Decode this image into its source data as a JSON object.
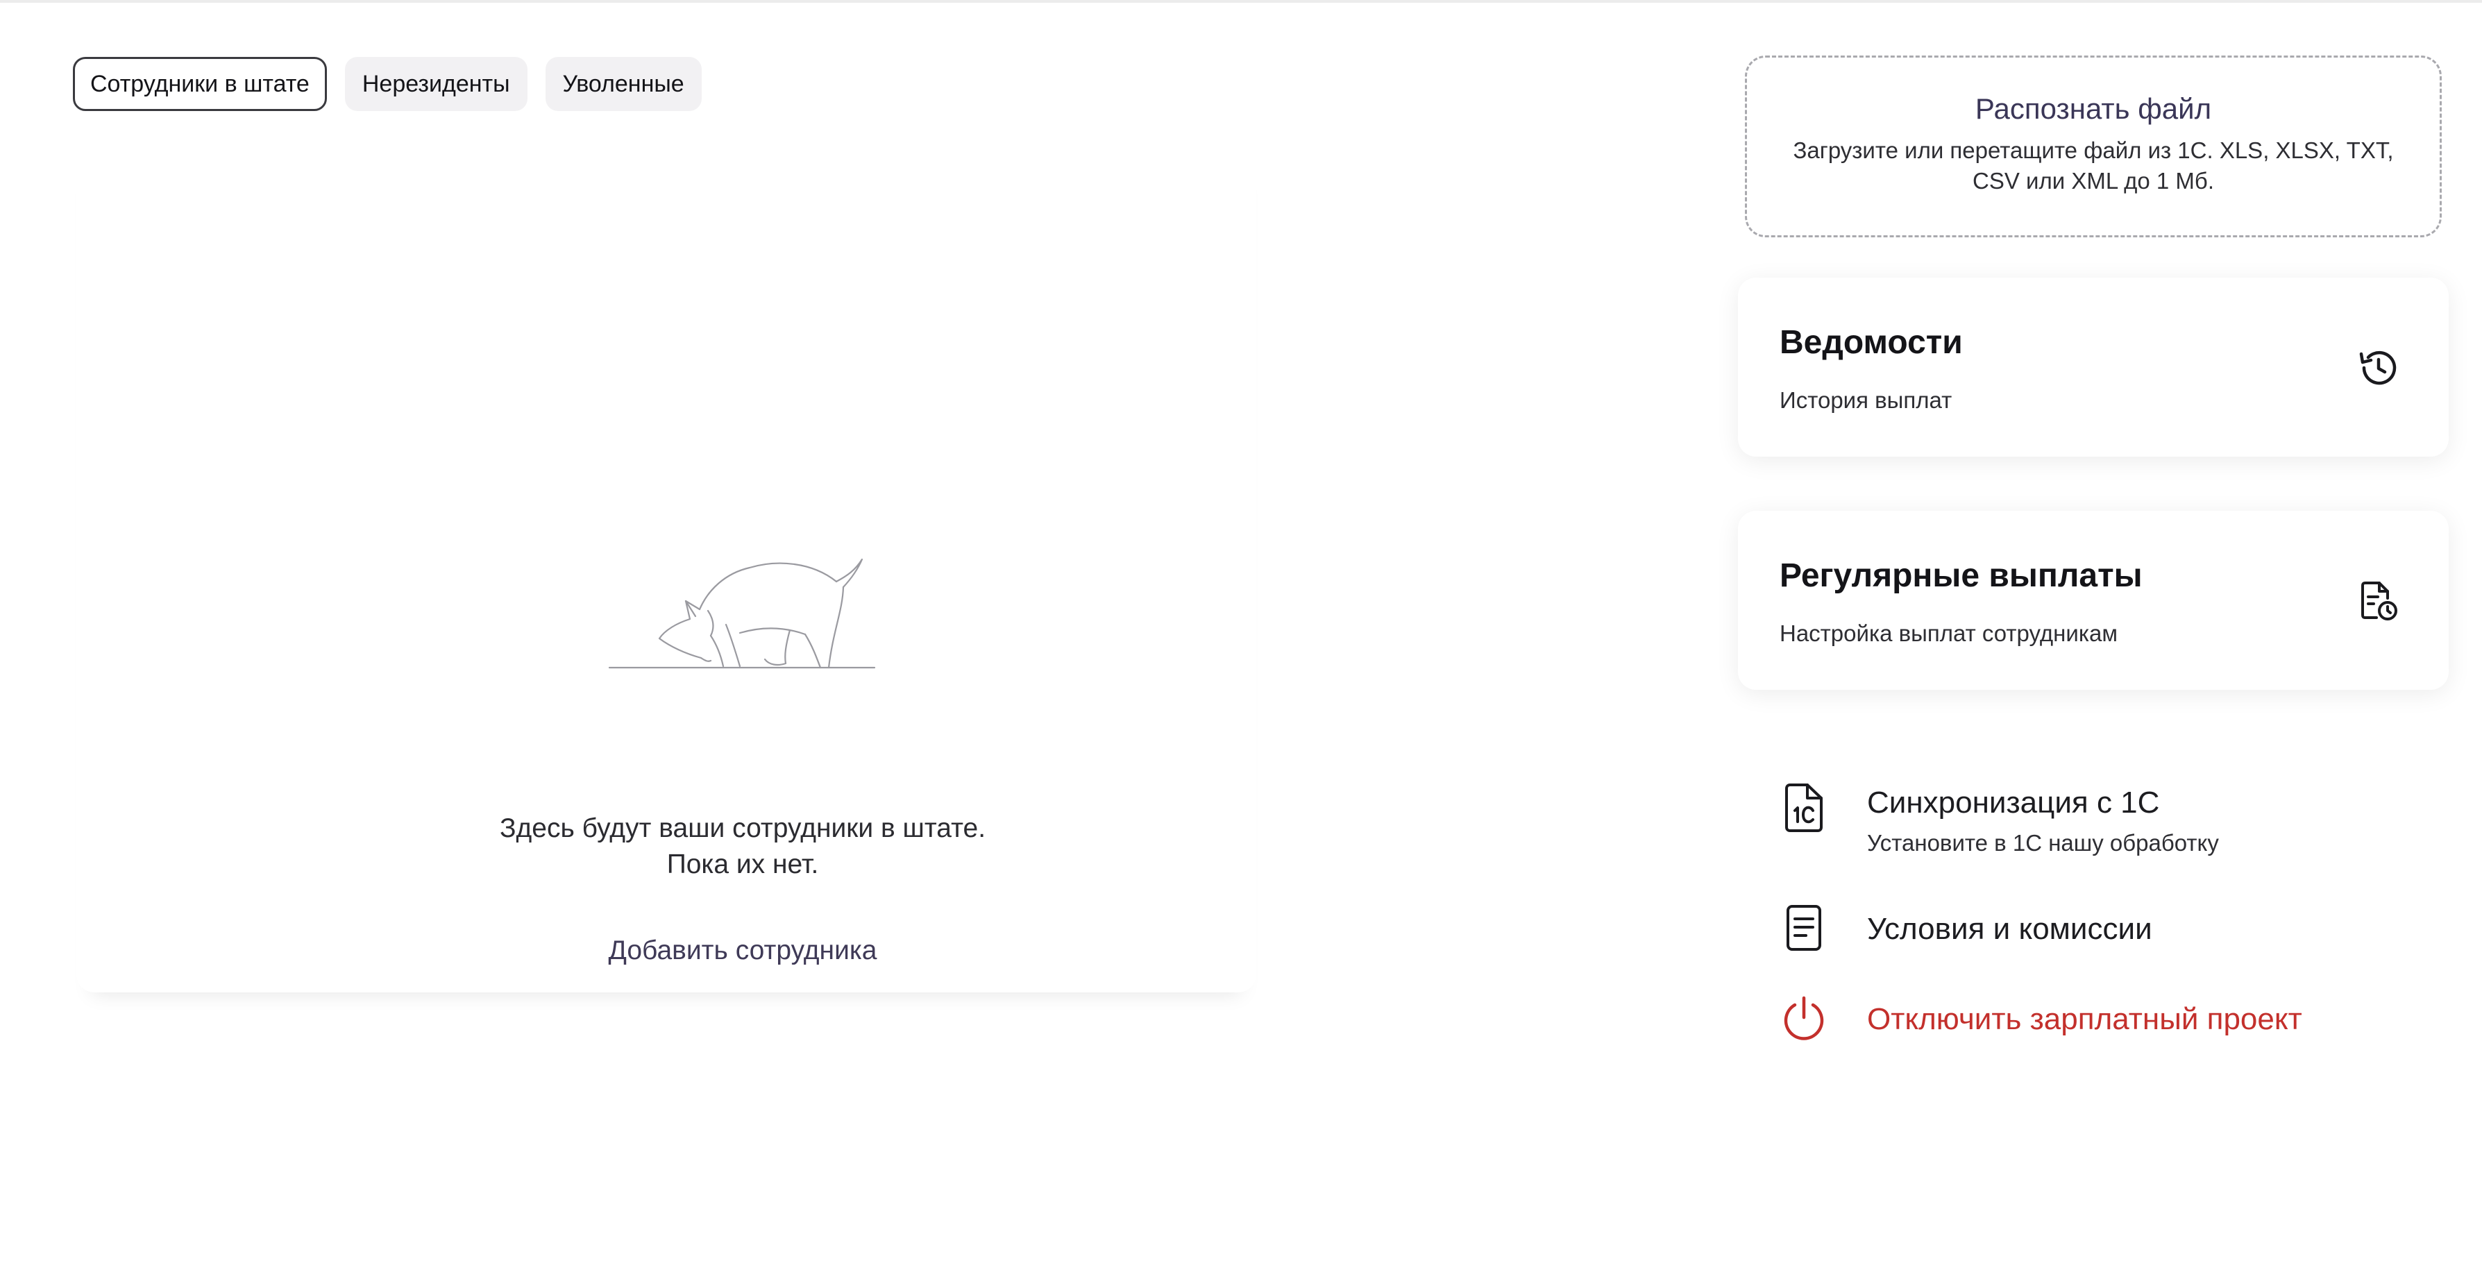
{
  "tabs": [
    {
      "label": "Сотрудники в штате",
      "active": true
    },
    {
      "label": "Нерезиденты",
      "active": false
    },
    {
      "label": "Уволенные",
      "active": false
    }
  ],
  "employees": {
    "empty_line1": "Здесь будут ваши сотрудники в штате.",
    "empty_line2": "Пока их нет.",
    "add_label": "Добавить сотрудника",
    "illustration_icon": "dog-sniffing-illustration"
  },
  "upload": {
    "title": "Распознать файл",
    "subtitle": "Загрузите или перетащите файл из 1С. XLS, XLSX, TXT, CSV или XML до 1 Мб."
  },
  "cards": [
    {
      "title": "Ведомости",
      "subtitle": "История выплат",
      "icon": "history-icon"
    },
    {
      "title": "Регулярные выплаты",
      "subtitle": "Настройка выплат сотрудникам",
      "icon": "document-clock-icon"
    }
  ],
  "links": {
    "sync": {
      "label": "Синхронизация с 1С",
      "sub": "Установите в 1С нашу обработку",
      "icon": "1c-file-icon"
    },
    "terms": {
      "label": "Условия и комиссии",
      "icon": "document-lines-icon"
    },
    "disable": {
      "label": "Отключить зарплатный проект",
      "icon": "power-icon"
    }
  },
  "colors": {
    "danger": "#c3302c",
    "accent_text": "#3f3a57",
    "tab_bg": "#f2f1f3"
  }
}
